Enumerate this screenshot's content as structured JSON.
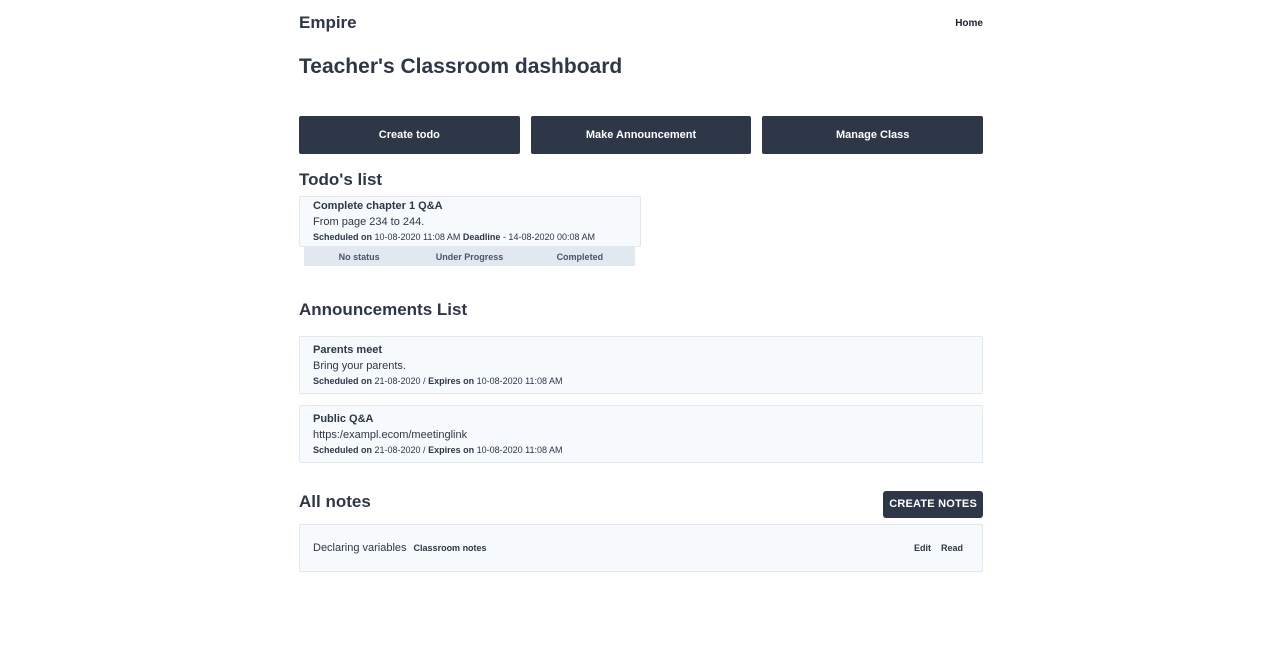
{
  "header": {
    "brand": "Empire",
    "nav_home": "Home"
  },
  "page": {
    "title": "Teacher's Classroom dashboard"
  },
  "actions": {
    "create_todo": "Create todo",
    "make_announcement": "Make Announcement",
    "manage_class": "Manage Class"
  },
  "todos": {
    "title": "Todo's list",
    "items": [
      {
        "title": "Complete chapter 1 Q&A",
        "body": "From page 234 to 244.",
        "scheduled_label": "Scheduled on",
        "scheduled_value": " 10-08-2020 11:08 AM ",
        "deadline_label": "Deadline",
        "deadline_value": " - 14-08-2020 00:08 AM",
        "status_options": [
          "No status",
          "Under Progress",
          "Completed"
        ]
      }
    ]
  },
  "announcements": {
    "title": "Announcements List",
    "items": [
      {
        "title": "Parents meet",
        "body": "Bring your parents.",
        "scheduled_label": "Scheduled on",
        "scheduled_value": " 21-08-2020 / ",
        "expires_label": "Expires on",
        "expires_value": " 10-08-2020 11:08 AM"
      },
      {
        "title": "Public Q&A",
        "body": "https:/exampl.ecom/meetinglink",
        "scheduled_label": "Scheduled on",
        "scheduled_value": " 21-08-2020 / ",
        "expires_label": "Expires on",
        "expires_value": " 10-08-2020 11:08 AM"
      }
    ]
  },
  "notes": {
    "title": "All notes",
    "create_label": "CREATE NOTES",
    "items": [
      {
        "name": "Declaring variables",
        "category": "Classroom notes",
        "edit_label": "Edit",
        "read_label": "Read"
      }
    ]
  }
}
